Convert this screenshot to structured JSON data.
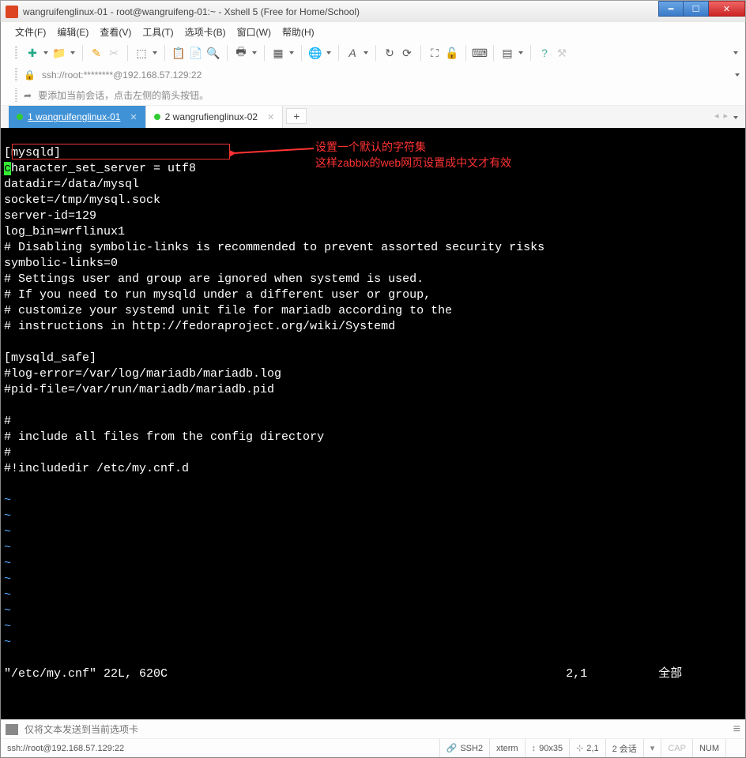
{
  "titlebar": {
    "title": "wangruifenglinux-01 - root@wangruifeng-01:~ - Xshell 5 (Free for Home/School)"
  },
  "menubar": {
    "items": [
      "文件(F)",
      "编辑(E)",
      "查看(V)",
      "工具(T)",
      "选项卡(B)",
      "窗口(W)",
      "帮助(H)"
    ]
  },
  "addressbar": {
    "path": "ssh://root:********@192.168.57.129:22"
  },
  "infobar": {
    "hint": "要添加当前会话，点击左侧的箭头按钮。"
  },
  "tabs": [
    {
      "label": "1 wangruifenglinux-01",
      "active": true
    },
    {
      "label": "2 wangrufienglinux-02",
      "active": false
    }
  ],
  "terminal": {
    "lines": [
      "[mysqld]",
      "character_set_server = utf8",
      "datadir=/data/mysql",
      "socket=/tmp/mysql.sock",
      "server-id=129",
      "log_bin=wrflinux1",
      "# Disabling symbolic-links is recommended to prevent assorted security risks",
      "symbolic-links=0",
      "# Settings user and group are ignored when systemd is used.",
      "# If you need to run mysqld under a different user or group,",
      "# customize your systemd unit file for mariadb according to the",
      "# instructions in http://fedoraproject.org/wiki/Systemd",
      "",
      "[mysqld_safe]",
      "#log-error=/var/log/mariadb/mariadb.log",
      "#pid-file=/var/run/mariadb/mariadb.pid",
      "",
      "#",
      "# include all files from the config directory",
      "#",
      "#!includedir /etc/my.cnf.d",
      ""
    ],
    "tilde_count": 10,
    "status_line": "\"/etc/my.cnf\" 22L, 620C",
    "cursor_pos": "2,1",
    "view_pos": "全部"
  },
  "annotation": {
    "line1": "设置一个默认的字符集",
    "line2": "这样zabbix的web网页设置成中文才有效"
  },
  "inputline": {
    "placeholder": "仅将文本发送到当前选项卡"
  },
  "statusbar": {
    "conn": "ssh://root@192.168.57.129:22",
    "proto": "SSH2",
    "term": "xterm",
    "size": "90x35",
    "pos": "2,1",
    "sessions": "2 会话",
    "cap": "CAP",
    "num": "NUM"
  }
}
